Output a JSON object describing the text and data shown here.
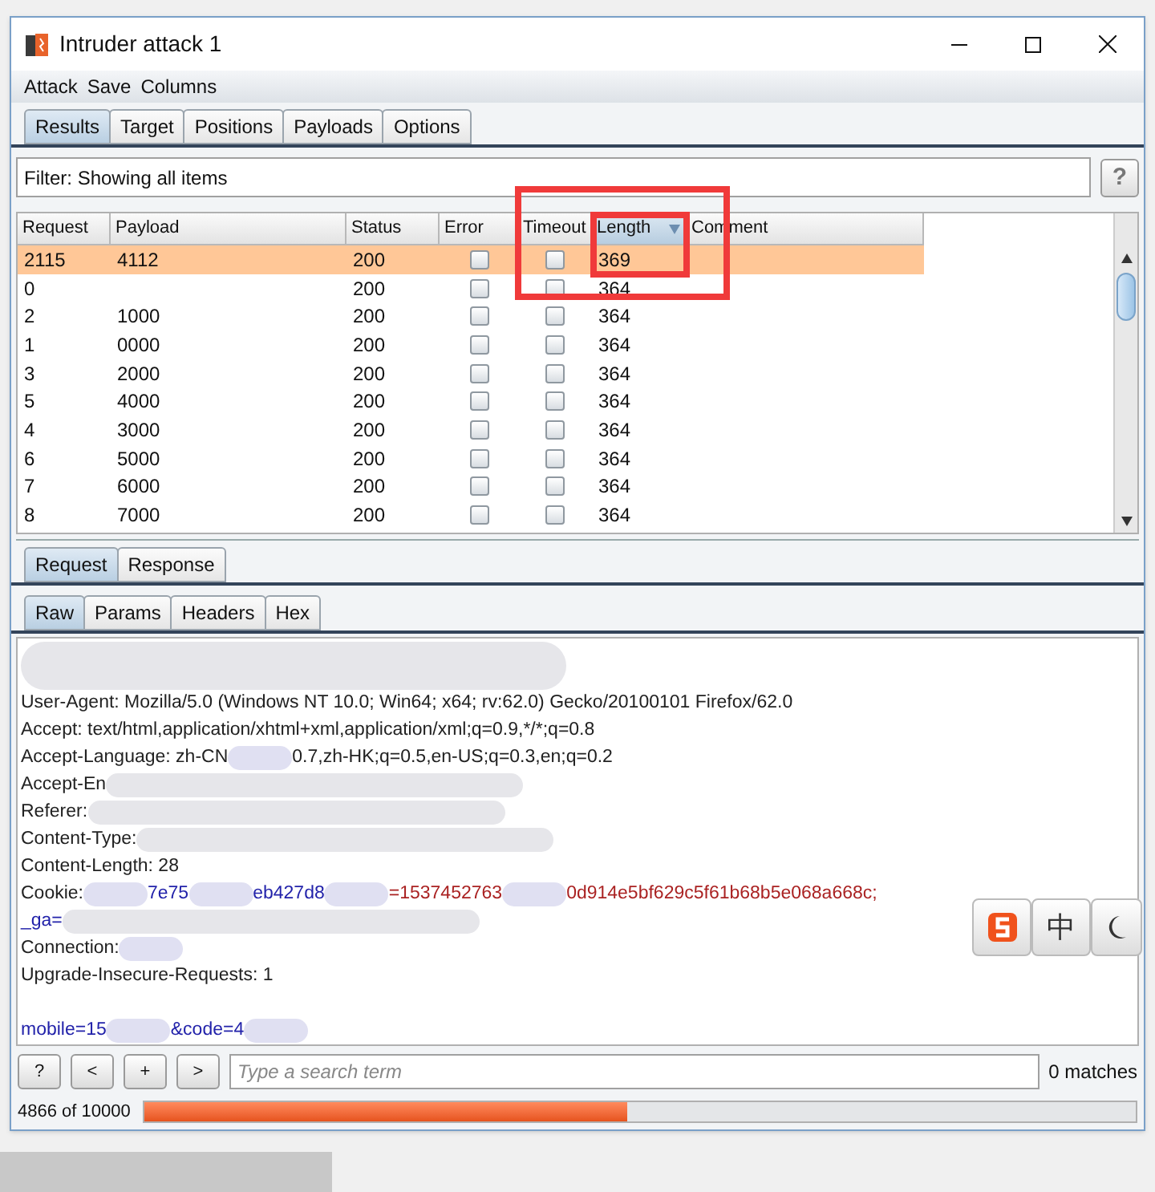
{
  "window": {
    "title": "Intruder attack 1"
  },
  "menu": [
    "Attack",
    "Save",
    "Columns"
  ],
  "tabs": [
    {
      "label": "Results",
      "selected": true
    },
    {
      "label": "Target",
      "selected": false
    },
    {
      "label": "Positions",
      "selected": false
    },
    {
      "label": "Payloads",
      "selected": false
    },
    {
      "label": "Options",
      "selected": false
    }
  ],
  "filter": {
    "text": "Filter: Showing all items",
    "help": "?"
  },
  "table": {
    "columns": [
      {
        "label": "Request",
        "sorted": false
      },
      {
        "label": "Payload",
        "sorted": false
      },
      {
        "label": "Status",
        "sorted": false
      },
      {
        "label": "Error",
        "sorted": false
      },
      {
        "label": "Timeout",
        "sorted": false
      },
      {
        "label": "Length",
        "sorted": true
      },
      {
        "label": "Comment",
        "sorted": false
      }
    ],
    "rows": [
      {
        "request": "2115",
        "payload": "4112",
        "status": "200",
        "error": false,
        "timeout": false,
        "length": "369",
        "selected": true
      },
      {
        "request": "0",
        "status": "200",
        "error": false,
        "timeout": false,
        "length": "364",
        "selected": false
      },
      {
        "request": "2",
        "payload": "1000",
        "status": "200",
        "error": false,
        "timeout": false,
        "length": "364",
        "selected": false
      },
      {
        "request": "1",
        "payload": "0000",
        "status": "200",
        "error": false,
        "timeout": false,
        "length": "364",
        "selected": false
      },
      {
        "request": "3",
        "payload": "2000",
        "status": "200",
        "error": false,
        "timeout": false,
        "length": "364",
        "selected": false
      },
      {
        "request": "5",
        "payload": "4000",
        "status": "200",
        "error": false,
        "timeout": false,
        "length": "364",
        "selected": false
      },
      {
        "request": "4",
        "payload": "3000",
        "status": "200",
        "error": false,
        "timeout": false,
        "length": "364",
        "selected": false
      },
      {
        "request": "6",
        "payload": "5000",
        "status": "200",
        "error": false,
        "timeout": false,
        "length": "364",
        "selected": false
      },
      {
        "request": "7",
        "payload": "6000",
        "status": "200",
        "error": false,
        "timeout": false,
        "length": "364",
        "selected": false
      },
      {
        "request": "8",
        "payload": "7000",
        "status": "200",
        "error": false,
        "timeout": false,
        "length": "364",
        "selected": false
      }
    ]
  },
  "message_tabs": [
    {
      "label": "Request",
      "selected": true
    },
    {
      "label": "Response",
      "selected": false
    }
  ],
  "view_tabs": [
    {
      "label": "Raw",
      "selected": true
    },
    {
      "label": "Params",
      "selected": false
    },
    {
      "label": "Headers",
      "selected": false
    },
    {
      "label": "Hex",
      "selected": false
    }
  ],
  "raw_lines": [
    [
      {
        "kind": "tall_blur"
      }
    ],
    [
      {
        "kind": "text",
        "text": "User-Agent: Mozilla/5.0 (Windows NT 10.0; Win64; x64; rv:62.0) Gecko/20100101 Firefox/62.0",
        "color": "#222222"
      }
    ],
    [
      {
        "kind": "text",
        "text": "Accept: text/html,application/xhtml+xml,application/xml;q=0.9,*/*;q=0.8",
        "color": "#222222"
      }
    ],
    [
      {
        "kind": "text",
        "text": "Accept-Language: zh-CN",
        "color": "#222222"
      },
      {
        "kind": "blur"
      },
      {
        "kind": "text",
        "text": "0.7,zh-HK;q=0.5,en-US;q=0.3,en;q=0.2",
        "color": "#222222"
      }
    ],
    [
      {
        "kind": "text",
        "text": "Accept-En",
        "color": "#222222"
      },
      {
        "kind": "wide_blur"
      }
    ],
    [
      {
        "kind": "text",
        "text": "Referer:",
        "color": "#222222"
      },
      {
        "kind": "wide_blur"
      }
    ],
    [
      {
        "kind": "text",
        "text": "Content-Type:",
        "color": "#222222"
      },
      {
        "kind": "wide_blur"
      }
    ],
    [
      {
        "kind": "text",
        "text": "Content-Length: 28",
        "color": "#222222"
      }
    ],
    [
      {
        "kind": "text",
        "text": "Cookie:",
        "color": "#222222"
      },
      {
        "kind": "blur"
      },
      {
        "kind": "text",
        "text": "7e75",
        "color": "#2222aa"
      },
      {
        "kind": "blur"
      },
      {
        "kind": "text",
        "text": "eb427d8",
        "color": "#2222aa"
      },
      {
        "kind": "blur"
      },
      {
        "kind": "text",
        "text": "=1537452763",
        "color": "#aa2222"
      },
      {
        "kind": "blur"
      },
      {
        "kind": "text",
        "text": "0d914e5bf629c5f61b68b5e068a668c;",
        "color": "#aa2222"
      }
    ],
    [
      {
        "kind": "text",
        "text": "_ga=",
        "color": "#2222aa"
      },
      {
        "kind": "wide_blur"
      }
    ],
    [
      {
        "kind": "text",
        "text": "Connection:",
        "color": "#222222"
      },
      {
        "kind": "blur"
      }
    ],
    [
      {
        "kind": "text",
        "text": "Upgrade-Insecure-Requests: 1",
        "color": "#222222"
      }
    ],
    [
      {
        "kind": "text",
        "text": "mobile=15",
        "color": "#2222aa"
      },
      {
        "kind": "blur"
      },
      {
        "kind": "text",
        "text": "&code=4",
        "color": "#2222aa"
      },
      {
        "kind": "blur"
      }
    ]
  ],
  "search": {
    "buttons": [
      "?",
      "<",
      "+",
      ">"
    ],
    "placeholder": "Type a search term",
    "matches": "0 matches"
  },
  "progress": {
    "text": "4866 of 10000",
    "level": 0.4866
  },
  "ime_toolbar": {
    "mode": "中"
  }
}
